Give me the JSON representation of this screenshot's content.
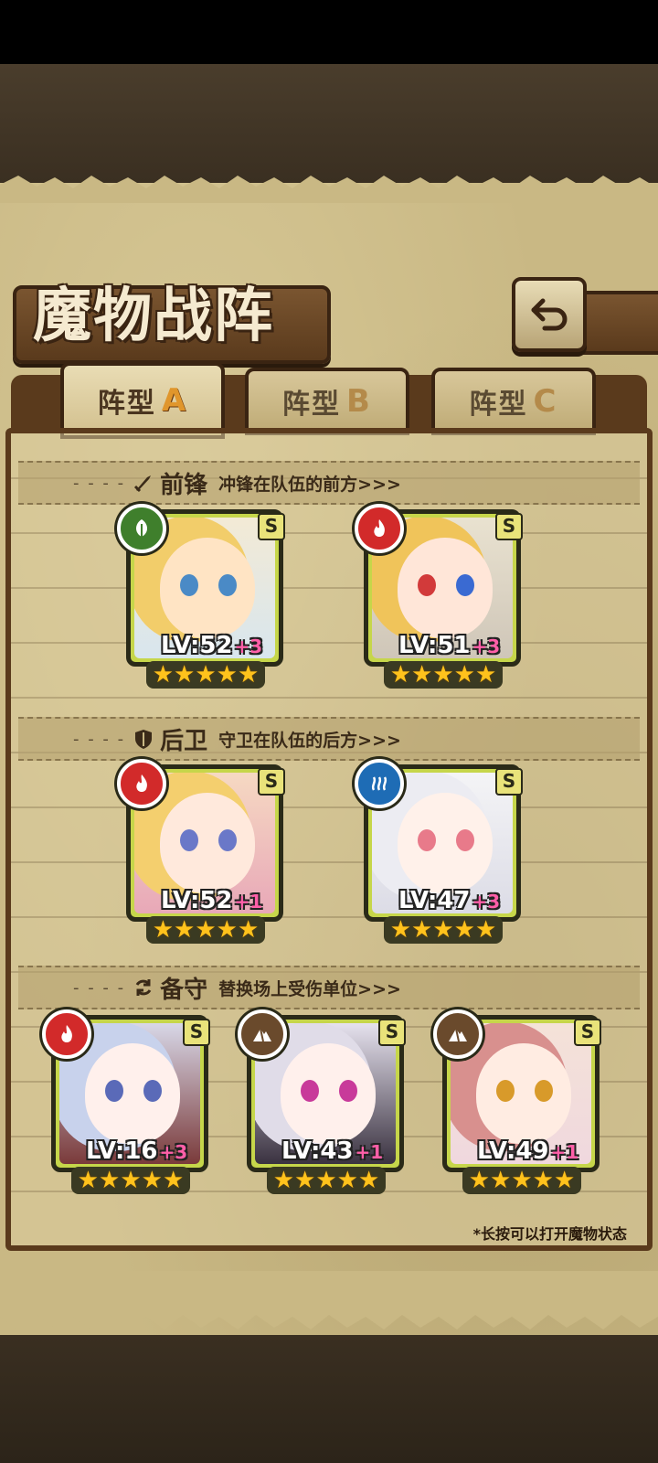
{
  "title": "魔物战阵",
  "tabs": [
    {
      "label": "阵型",
      "letter": "A",
      "active": true
    },
    {
      "label": "阵型",
      "letter": "B",
      "active": false
    },
    {
      "label": "阵型",
      "letter": "C",
      "active": false
    }
  ],
  "sections": {
    "front": {
      "name": "前锋",
      "desc": "冲锋在队伍的前方>>>"
    },
    "rear": {
      "name": "后卫",
      "desc": "守卫在队伍的后方>>>"
    },
    "reserve": {
      "name": "备守",
      "desc": "替换场上受伤单位>>>"
    }
  },
  "rank_label": "S",
  "units": {
    "front1": {
      "lv": "LV:52",
      "plus": "+3",
      "element": "leaf",
      "stars": 5
    },
    "front2": {
      "lv": "LV:51",
      "plus": "+3",
      "element": "fire",
      "stars": 5
    },
    "rear1": {
      "lv": "LV:52",
      "plus": "+1",
      "element": "fire",
      "stars": 5
    },
    "rear2": {
      "lv": "LV:47",
      "plus": "+3",
      "element": "water",
      "stars": 5
    },
    "res1": {
      "lv": "LV:16",
      "plus": "+3",
      "element": "fire",
      "stars": 5
    },
    "res2": {
      "lv": "LV:43",
      "plus": "+1",
      "element": "earth",
      "stars": 5
    },
    "res3": {
      "lv": "LV:49",
      "plus": "+1",
      "element": "earth",
      "stars": 5
    }
  },
  "footnote": "*长按可以打开魔物状态"
}
